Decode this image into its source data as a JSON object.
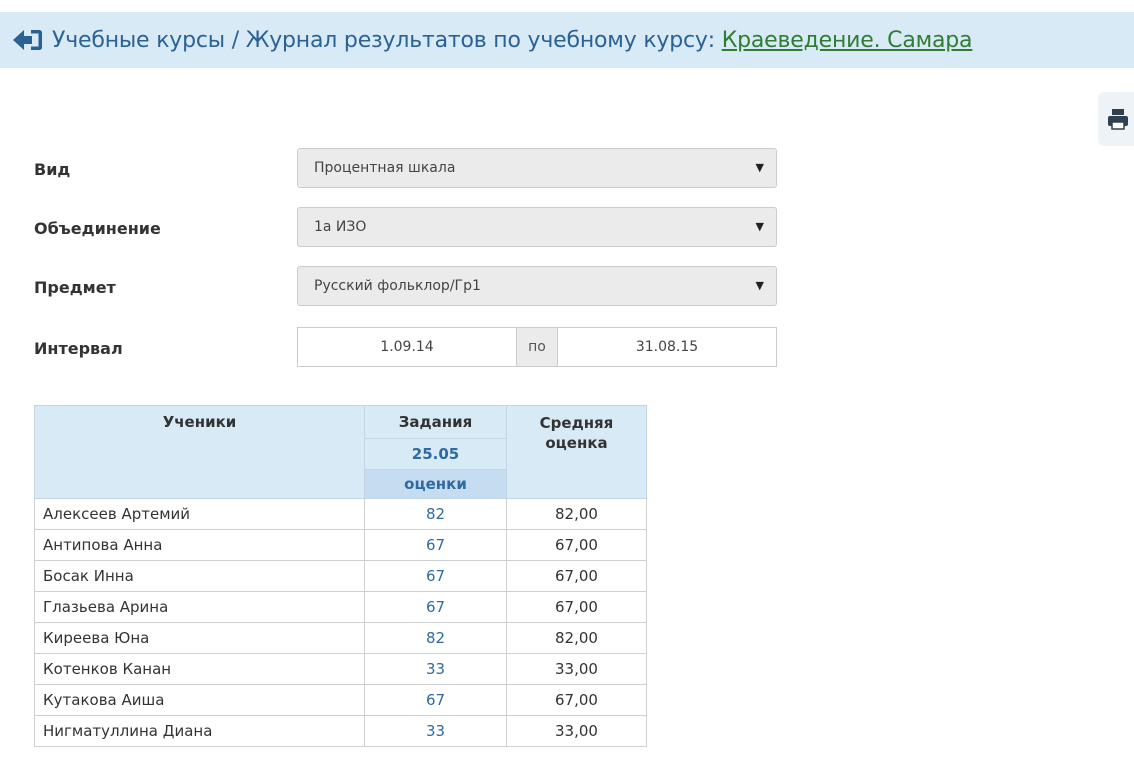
{
  "header": {
    "title_prefix": "Учебные курсы / Журнал результатов по учебному курсу: ",
    "course_link": "Краеведение. Самара",
    "back_icon": "sign-out-arrow-icon",
    "print_icon": "printer-icon"
  },
  "filters": {
    "view": {
      "label": "Вид",
      "value": "Процентная шкала"
    },
    "group": {
      "label": "Объединение",
      "value": "1а ИЗО"
    },
    "subject": {
      "label": "Предмет",
      "value": "Русский фольклор/Гр1"
    },
    "interval": {
      "label": "Интервал",
      "from": "1.09.14",
      "separator": "по",
      "to": "31.08.15"
    }
  },
  "table": {
    "headers": {
      "students": "Ученики",
      "tasks": "Задания",
      "task_date": "25.05",
      "task_type": "оценки",
      "average": "Средняя оценка"
    },
    "rows": [
      {
        "name": "Алексеев Артемий",
        "grade": "82",
        "avg": "82,00"
      },
      {
        "name": "Антипова Анна",
        "grade": "67",
        "avg": "67,00"
      },
      {
        "name": "Босак Инна",
        "grade": "67",
        "avg": "67,00"
      },
      {
        "name": "Глазьева Арина",
        "grade": "67",
        "avg": "67,00"
      },
      {
        "name": "Киреева Юна",
        "grade": "82",
        "avg": "82,00"
      },
      {
        "name": "Котенков Канан",
        "grade": "33",
        "avg": "33,00"
      },
      {
        "name": "Кутакова Аиша",
        "grade": "67",
        "avg": "67,00"
      },
      {
        "name": "Нигматуллина Диана",
        "grade": "33",
        "avg": "33,00"
      }
    ]
  },
  "colors": {
    "header_bg": "#d9eaf7",
    "title_text": "#2b6296",
    "link": "#2e7d32",
    "grade_text": "#2f6aa3",
    "select_bg": "#ebebeb"
  }
}
